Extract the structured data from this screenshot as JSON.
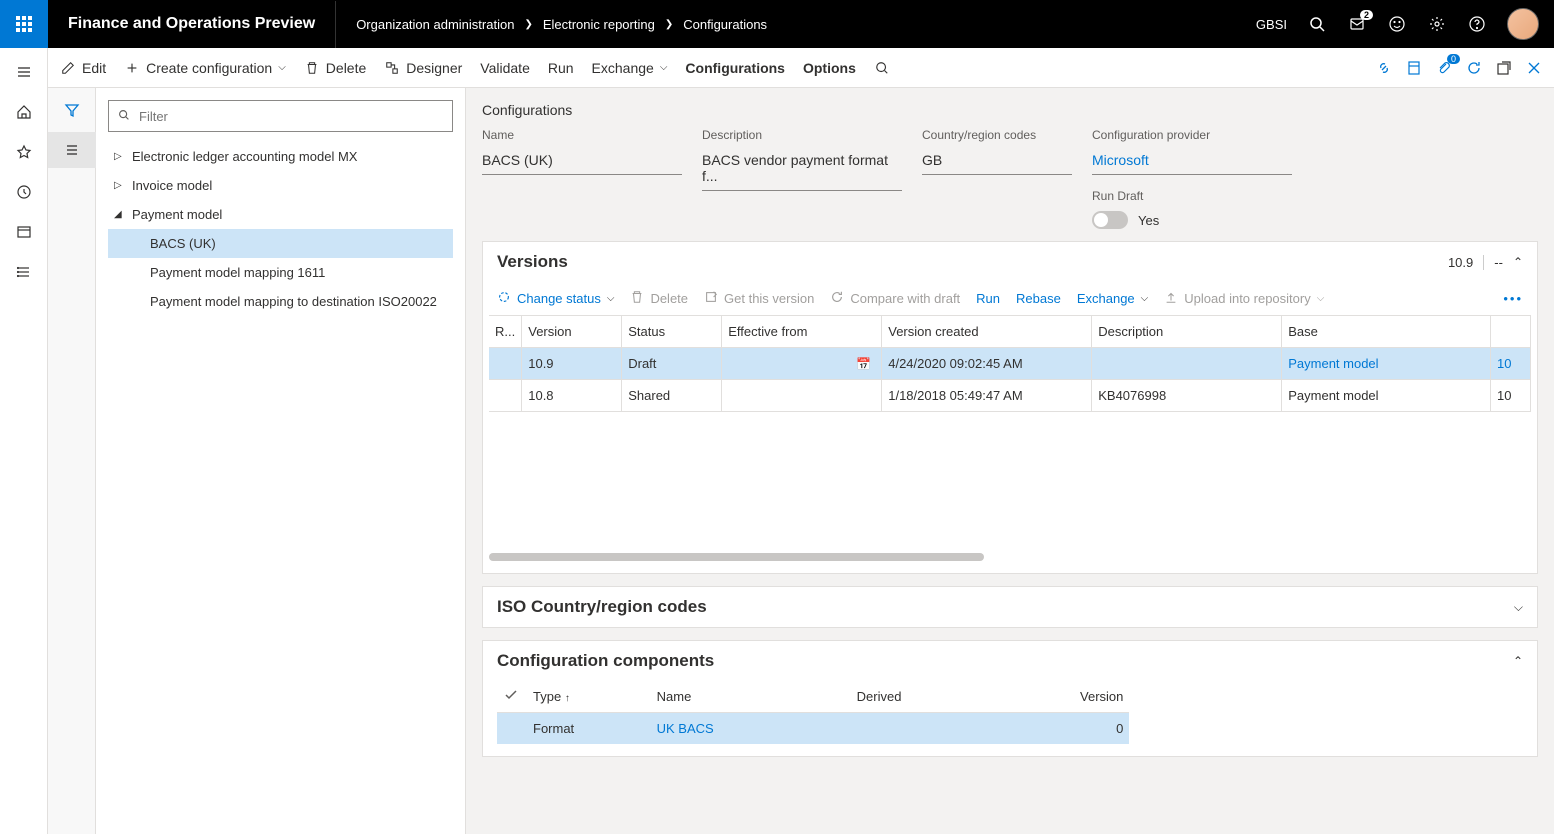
{
  "topBar": {
    "appTitle": "Finance and Operations Preview",
    "breadcrumb": [
      "Organization administration",
      "Electronic reporting",
      "Configurations"
    ],
    "company": "GBSI",
    "notificationCount": "2"
  },
  "commandBar": {
    "edit": "Edit",
    "createConfig": "Create configuration",
    "delete": "Delete",
    "designer": "Designer",
    "validate": "Validate",
    "run": "Run",
    "exchange": "Exchange",
    "configurations": "Configurations",
    "options": "Options",
    "attachBadge": "0"
  },
  "filterBox": {
    "placeholder": "Filter"
  },
  "tree": {
    "items": [
      {
        "label": "Electronic ledger accounting model MX",
        "expanded": false,
        "indent": 1
      },
      {
        "label": "Invoice model",
        "expanded": false,
        "indent": 1
      },
      {
        "label": "Payment model",
        "expanded": true,
        "indent": 1
      },
      {
        "label": "BACS (UK)",
        "selected": true,
        "indent": 2
      },
      {
        "label": "Payment model mapping 1611",
        "indent": 2
      },
      {
        "label": "Payment model mapping to destination ISO20022",
        "indent": 2
      }
    ]
  },
  "detail": {
    "header": "Configurations",
    "fields": {
      "nameLabel": "Name",
      "name": "BACS (UK)",
      "descLabel": "Description",
      "desc": "BACS vendor payment format f...",
      "regionLabel": "Country/region codes",
      "region": "GB",
      "providerLabel": "Configuration provider",
      "provider": "Microsoft",
      "runDraftLabel": "Run Draft",
      "runDraftValue": "Yes"
    }
  },
  "versions": {
    "title": "Versions",
    "headerVersion": "10.9",
    "headerDash": "--",
    "toolbar": {
      "changeStatus": "Change status",
      "delete": "Delete",
      "getVersion": "Get this version",
      "compare": "Compare with draft",
      "run": "Run",
      "rebase": "Rebase",
      "exchange": "Exchange",
      "upload": "Upload into repository"
    },
    "columns": [
      "R...",
      "Version",
      "Status",
      "Effective from",
      "Version created",
      "Description",
      "Base",
      ""
    ],
    "rows": [
      {
        "version": "10.9",
        "status": "Draft",
        "effective": "",
        "hasCalIcon": true,
        "created": "4/24/2020 09:02:45 AM",
        "description": "",
        "base": "Payment model",
        "baseVer": "10",
        "selected": true
      },
      {
        "version": "10.8",
        "status": "Shared",
        "effective": "",
        "hasCalIcon": false,
        "created": "1/18/2018 05:49:47 AM",
        "description": "KB4076998",
        "base": "Payment model",
        "baseVer": "10",
        "selected": false
      }
    ]
  },
  "isoSection": {
    "title": "ISO Country/region codes"
  },
  "components": {
    "title": "Configuration components",
    "columns": [
      "Type",
      "Name",
      "Derived",
      "Version"
    ],
    "rows": [
      {
        "type": "Format",
        "name": "UK BACS",
        "derived": "",
        "version": "0",
        "selected": true
      }
    ]
  }
}
